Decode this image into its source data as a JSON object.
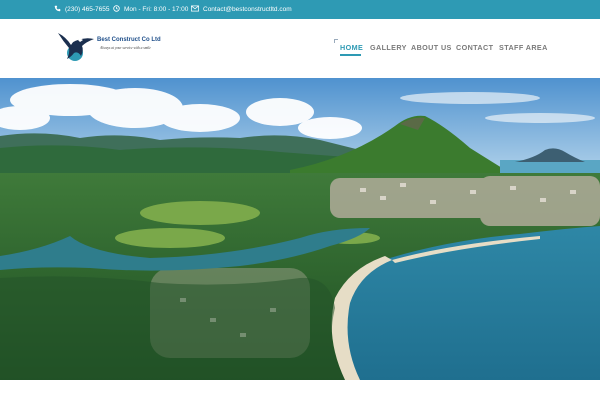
{
  "topbar": {
    "phone": "(230) 465-7655",
    "hours": "Mon - Fri: 8:00 - 17:00",
    "email": "Contact@bestconstructltd.com",
    "phone_icon": "phone-icon",
    "hours_icon": "clock-icon",
    "email_icon": "envelope-icon"
  },
  "logo": {
    "name": "Best Construct Co Ltd",
    "tagline": "Always at your service with a smile",
    "icon": "eagle-icon"
  },
  "nav": {
    "items": [
      "HOME",
      "GALLERY",
      "ABOUT US",
      "CONTACT",
      "STAFF AREA"
    ],
    "active": "HOME"
  },
  "hero": {
    "image": "aerial-coastline-photo"
  },
  "colors": {
    "accent": "#2e9ab4",
    "nav_text": "#7a7a7a",
    "logo_text": "#1f4f8a"
  }
}
